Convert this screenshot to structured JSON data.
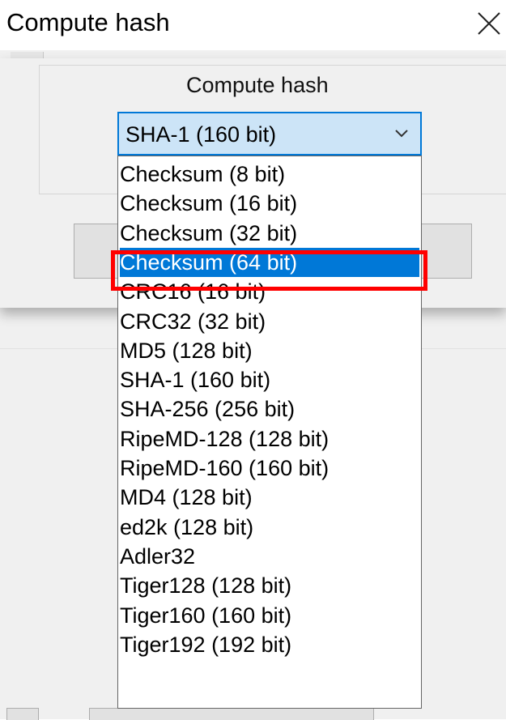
{
  "window": {
    "title": "Compute hash",
    "close_icon": "close-icon"
  },
  "group": {
    "label": "Compute hash"
  },
  "combo": {
    "selected": "SHA-1 (160 bit)",
    "arrow_icon": "chevron-down-icon"
  },
  "dropdown": {
    "highlighted_index": 3,
    "options": [
      "Checksum (8 bit)",
      "Checksum (16 bit)",
      "Checksum (32 bit)",
      "Checksum (64 bit)",
      "CRC16 (16 bit)",
      "CRC32 (32 bit)",
      "MD5 (128 bit)",
      " SHA-1 (160 bit)",
      " SHA-256 (256 bit)",
      "RipeMD-128 (128 bit)",
      "RipeMD-160 (160 bit)",
      "MD4 (128 bit)",
      "ed2k (128 bit)",
      "Adler32",
      "Tiger128 (128 bit)",
      "Tiger160 (160 bit)",
      "Tiger192 (192 bit)"
    ]
  },
  "colors": {
    "selection": "#0078d7",
    "annotation_box": "#ff0000",
    "combo_fill": "#cce4f7"
  }
}
